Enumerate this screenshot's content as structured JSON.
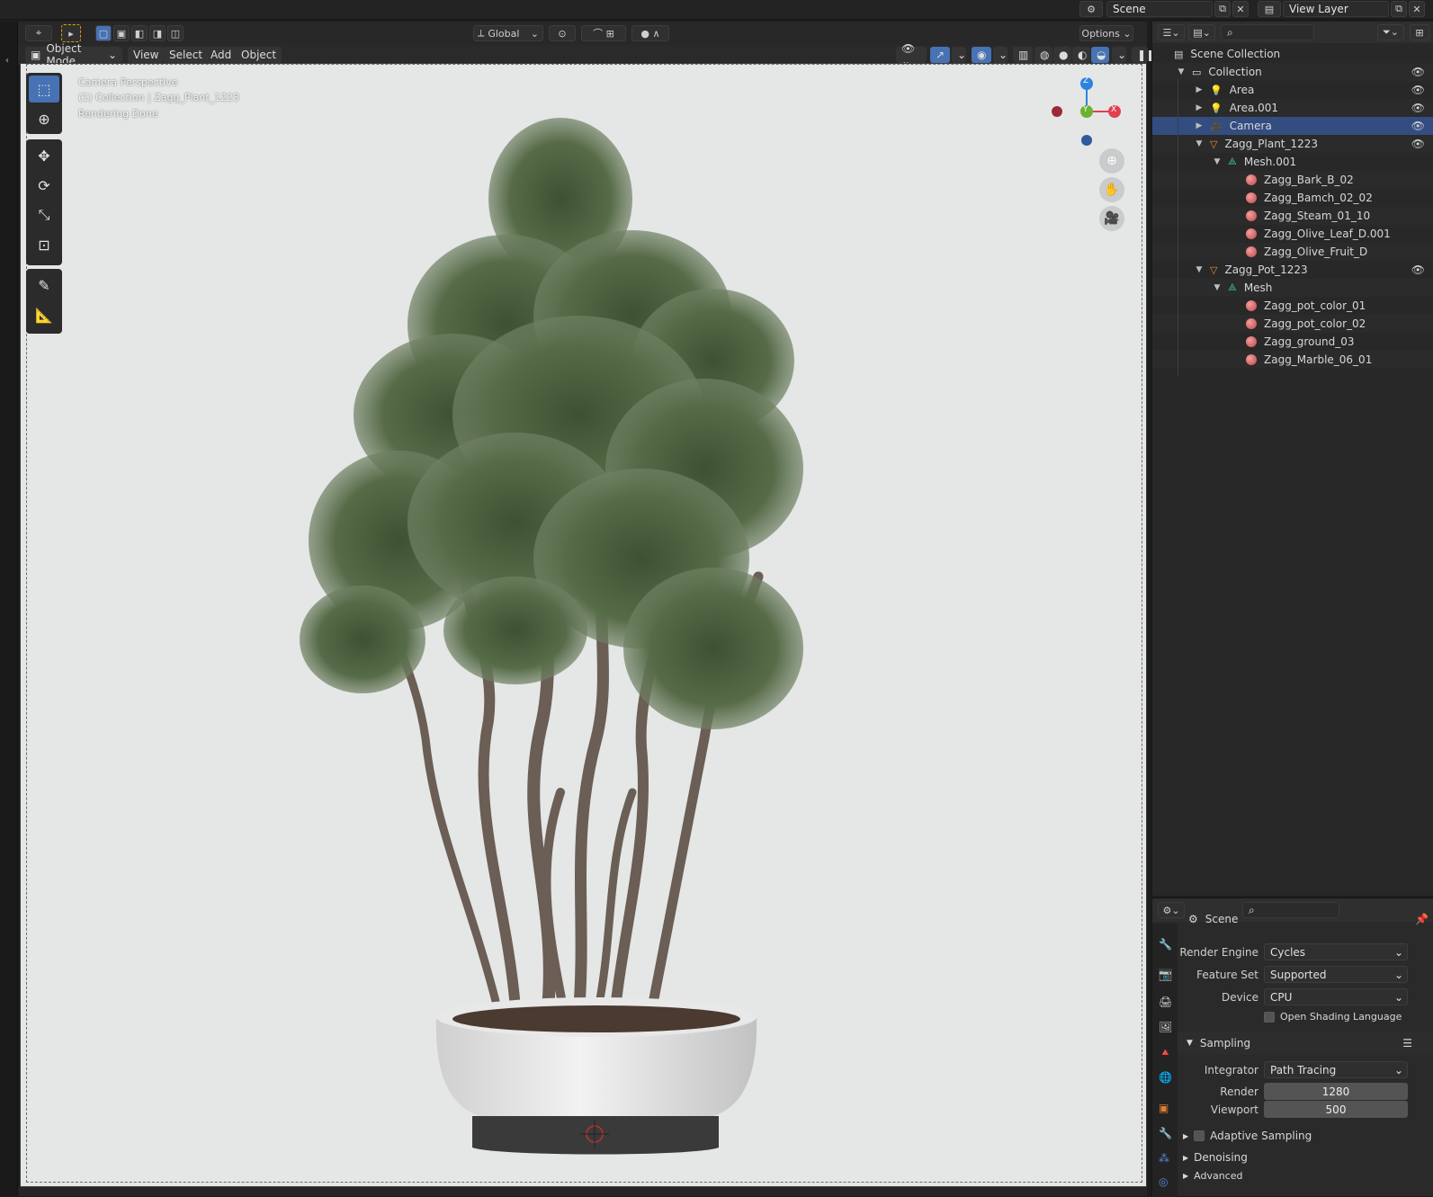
{
  "topbar": {
    "scene_label": "Scene",
    "view_layer_label": "View Layer"
  },
  "viewport_header": {
    "orientation": "Global",
    "options_label": "Options",
    "mode": "Object Mode",
    "menus": [
      "View",
      "Select",
      "Add",
      "Object"
    ]
  },
  "viewport": {
    "overlay_line1": "Camera Perspective",
    "overlay_line2": "(1) Collection | Zagg_Plant_1223",
    "overlay_line3": "Rendering Done",
    "gizmo": {
      "z": "Z",
      "y": "Y",
      "x": "X"
    }
  },
  "outliner": {
    "rows": [
      {
        "label": "Scene Collection",
        "level": 0,
        "icon": "scene-collection-icon"
      },
      {
        "label": "Collection",
        "level": 1,
        "icon": "collection-icon"
      },
      {
        "label": "Area",
        "level": 2,
        "icon": "light-icon"
      },
      {
        "label": "Area.001",
        "level": 2,
        "icon": "light-icon"
      },
      {
        "label": "Camera",
        "level": 2,
        "icon": "camera-icon"
      },
      {
        "label": "Zagg_Plant_1223",
        "level": 2,
        "icon": "mesh-object-icon"
      },
      {
        "label": "Mesh.001",
        "level": 3,
        "icon": "mesh-data-icon"
      },
      {
        "label": "Zagg_Bark_B_02",
        "level": 4,
        "icon": "material-icon"
      },
      {
        "label": "Zagg_Bamch_02_02",
        "level": 4,
        "icon": "material-icon"
      },
      {
        "label": "Zagg_Steam_01_10",
        "level": 4,
        "icon": "material-icon"
      },
      {
        "label": "Zagg_Olive_Leaf_D.001",
        "level": 4,
        "icon": "material-icon"
      },
      {
        "label": "Zagg_Olive_Fruit_D",
        "level": 4,
        "icon": "material-icon"
      },
      {
        "label": "Zagg_Pot_1223",
        "level": 2,
        "icon": "mesh-object-icon"
      },
      {
        "label": "Mesh",
        "level": 3,
        "icon": "mesh-data-icon"
      },
      {
        "label": "Zagg_pot_color_01",
        "level": 4,
        "icon": "material-icon"
      },
      {
        "label": "Zagg_pot_color_02",
        "level": 4,
        "icon": "material-icon"
      },
      {
        "label": "Zagg_ground_03",
        "level": 4,
        "icon": "material-icon"
      },
      {
        "label": "Zagg_Marble_06_01",
        "level": 4,
        "icon": "material-icon"
      }
    ]
  },
  "properties": {
    "context": "Scene",
    "render_engine_label": "Render Engine",
    "render_engine": "Cycles",
    "feature_set_label": "Feature Set",
    "feature_set": "Supported",
    "device_label": "Device",
    "device": "CPU",
    "osl_label": "Open Shading Language",
    "sampling_label": "Sampling",
    "integrator_label": "Integrator",
    "integrator": "Path Tracing",
    "render_label": "Render",
    "render_samples": "1280",
    "viewport_label": "Viewport",
    "viewport_samples": "500",
    "adaptive_label": "Adaptive Sampling",
    "denoising_label": "Denoising",
    "advanced_label": "Advanced"
  },
  "colors": {
    "accent": "#4772b3",
    "selection": "#334d80",
    "viewport_bg": "#e5e6e6"
  }
}
